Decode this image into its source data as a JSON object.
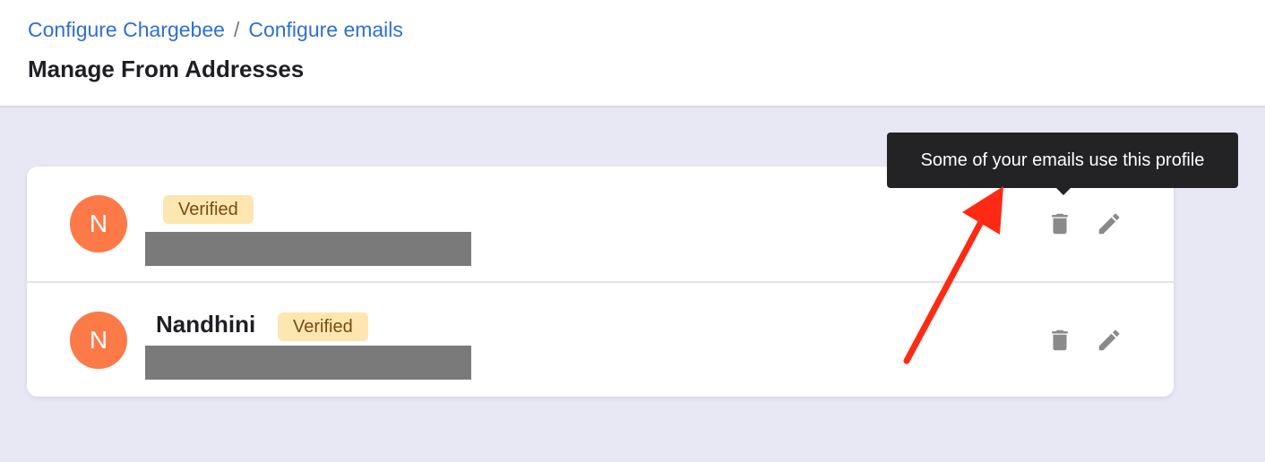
{
  "breadcrumb": {
    "items": [
      "Configure Chargebee",
      "Configure emails"
    ],
    "separator": "/"
  },
  "page_title": "Manage From Addresses",
  "addresses": [
    {
      "avatar_initial": "N",
      "name": "",
      "badge": "Verified"
    },
    {
      "avatar_initial": "N",
      "name": "Nandhini",
      "badge": "Verified"
    }
  ],
  "tooltip": {
    "text": "Some of your emails use this profile"
  },
  "icons": {
    "delete": "trash-icon",
    "edit": "pencil-icon",
    "annotation": "red-arrow"
  },
  "colors": {
    "link": "#2f6fd6",
    "avatar": "#fb7a48",
    "badge_bg": "#fde6b0",
    "badge_text": "#7a4a10",
    "tooltip_bg": "#232326",
    "annotation_arrow": "#ff2a14",
    "page_bg": "#e8e8f4"
  }
}
